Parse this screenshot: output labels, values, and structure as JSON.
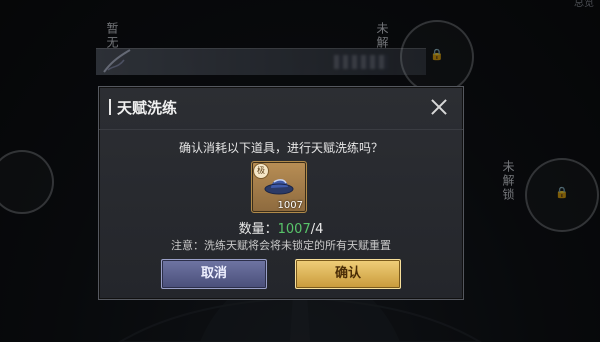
{
  "background": {
    "left_label": "暂无",
    "right_label_top": "未解",
    "right_label_mid": "未解锁",
    "corner_text": "总览"
  },
  "dialog": {
    "title": "天赋洗练",
    "confirm_prompt": "确认消耗以下道具，进行天赋洗练吗？",
    "item": {
      "rarity_badge": "极",
      "count": "1007",
      "icon": "hat-icon"
    },
    "quantity_label": "数量：",
    "quantity_owned": "1007",
    "quantity_required": "/4",
    "notice": "注意：洗练天赋将会将未锁定的所有天赋重置",
    "cancel_label": "取消",
    "confirm_label": "确认"
  },
  "colors": {
    "owned_green": "#58c46a",
    "confirm_gold": "#e0b85a",
    "cancel_purple": "#5a608c"
  }
}
